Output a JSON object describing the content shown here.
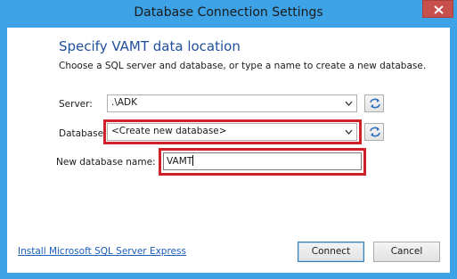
{
  "window": {
    "title": "Database Connection Settings"
  },
  "content": {
    "heading": "Specify VAMT data location",
    "description": "Choose a SQL server and database, or type a name to create a new database."
  },
  "form": {
    "server_label": "Server:",
    "server_value": ".\\ADK",
    "database_label": "Database:",
    "database_value": "<Create new database>",
    "new_db_label": "New database name:",
    "new_db_value": "VAMT"
  },
  "footer": {
    "link_text": "Install Microsoft SQL Server Express",
    "connect_label": "Connect",
    "cancel_label": "Cancel"
  },
  "colors": {
    "titlebar": "#3da3e6",
    "heading": "#1f4f9a",
    "link": "#1b5eb8",
    "highlight": "#d0202a",
    "close_button": "#c7504d"
  },
  "icons": [
    "close-icon",
    "dropdown-arrow-icon",
    "refresh-icon"
  ]
}
